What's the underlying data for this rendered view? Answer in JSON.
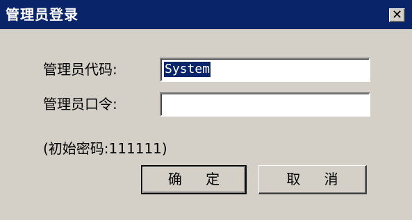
{
  "window": {
    "title": "管理员登录",
    "close_label": "✕"
  },
  "form": {
    "code_label": "管理员代码:",
    "code_value": "System",
    "password_label": "管理员口令:",
    "password_value": "",
    "hint": "(初始密码:111111)"
  },
  "buttons": {
    "ok": "确 定",
    "cancel": "取 消"
  }
}
